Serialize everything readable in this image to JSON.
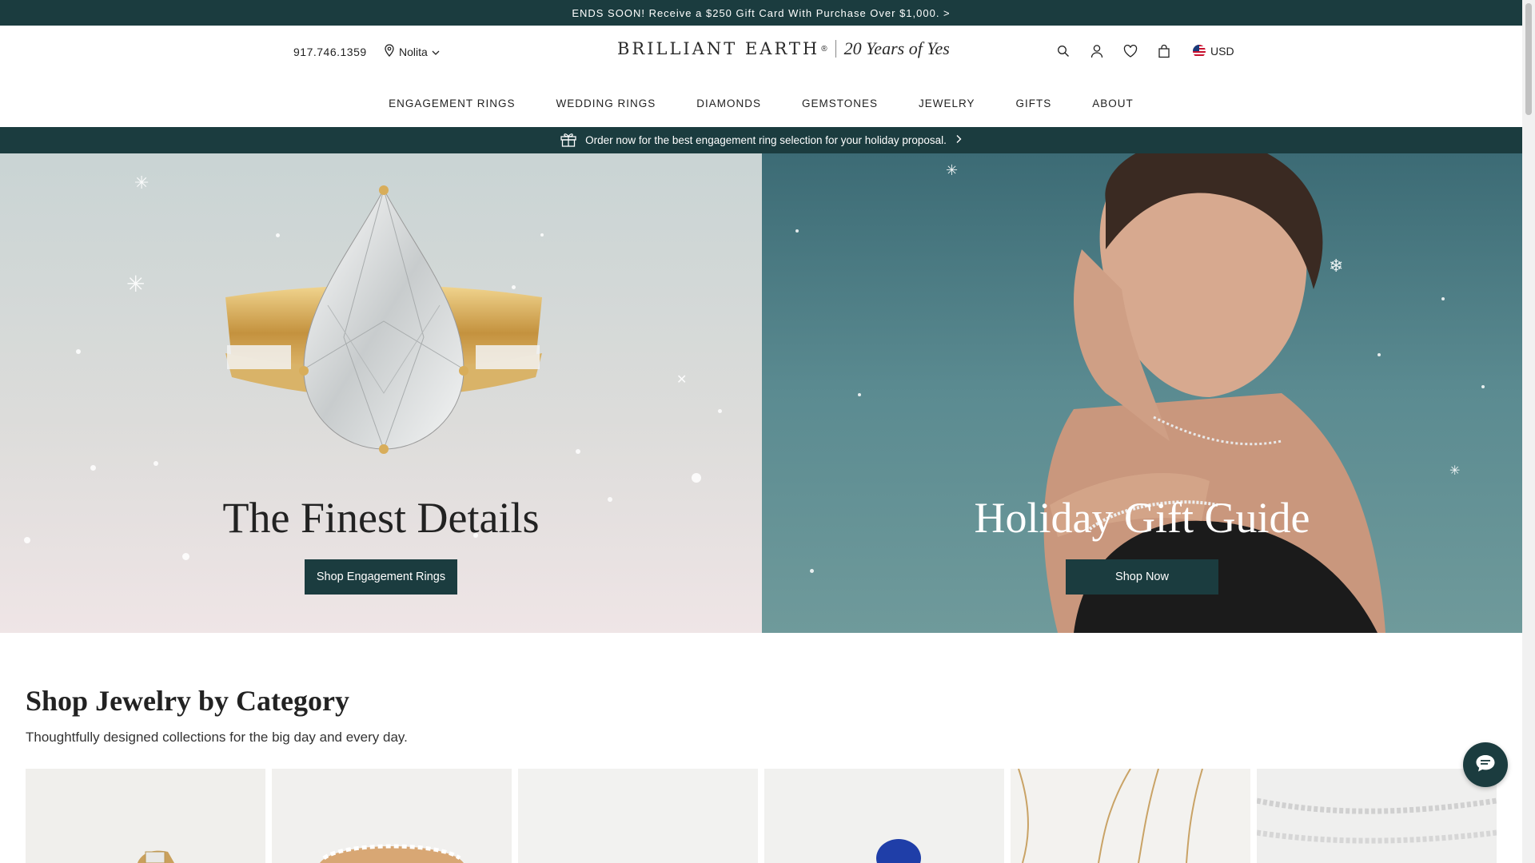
{
  "promo_bar": {
    "text": "ENDS SOON! Receive a $250 Gift Card With Purchase Over $1,000. >"
  },
  "header": {
    "phone": "917.746.1359",
    "location": "Nolita",
    "logo_brand": "BRILLIANT EARTH",
    "logo_trademark": "®",
    "logo_tagline": "20 Years of Yes",
    "currency": "USD",
    "icons": [
      "search-icon",
      "account-icon",
      "wishlist-heart-icon",
      "shopping-bag-icon",
      "us-flag-icon"
    ]
  },
  "nav": {
    "items": [
      {
        "label": "ENGAGEMENT RINGS"
      },
      {
        "label": "WEDDING RINGS"
      },
      {
        "label": "DIAMONDS"
      },
      {
        "label": "GEMSTONES"
      },
      {
        "label": "JEWELRY"
      },
      {
        "label": "GIFTS"
      },
      {
        "label": "ABOUT"
      }
    ]
  },
  "sub_banner": {
    "text": "Order now for the best engagement ring selection for your holiday proposal."
  },
  "hero": {
    "left": {
      "title": "The Finest Details",
      "button": "Shop Engagement Rings"
    },
    "right": {
      "title": "Holiday Gift Guide",
      "button": "Shop Now"
    }
  },
  "category_section": {
    "title": "Shop Jewelry by Category",
    "subtitle": "Thoughtfully designed collections for the big day and every day."
  },
  "colors": {
    "brand_dark_green": "#1b3c3f",
    "white": "#ffffff",
    "text": "#222222"
  }
}
